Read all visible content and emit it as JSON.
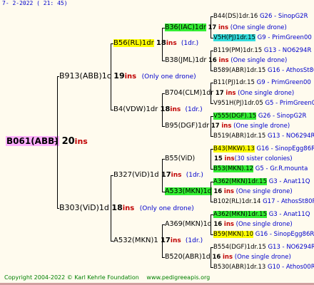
{
  "header": {
    "date": "7-  2-2022 ( 21: 45)"
  },
  "footer": {
    "copyright": "Copyright 2004-2022 © Karl Kehrle Foundation",
    "site": "www.pedigreeapis.org"
  },
  "colors": {
    "yellow": "#ffff00",
    "green": "#33ee33",
    "cyan": "#33dddd",
    "root": "#ffb0ff"
  },
  "tree": {
    "root": {
      "name": "B061(ABB)",
      "num": "20",
      "ins": "ins"
    },
    "g1": [
      {
        "name": "B913(ABB)1c",
        "num": "19",
        "ins": "ins",
        "note": "(Only one drone)"
      },
      {
        "name": "B303(ViD)1d",
        "num": "18",
        "ins": "ins",
        "note": "(Only one drone)"
      }
    ],
    "g2": [
      {
        "name": "B56(RL)1dr",
        "num": "18",
        "ins": "ins",
        "note": "(1dr.)"
      },
      {
        "name": "B4(VDW)1dr",
        "num": "18",
        "ins": "ins",
        "note": "(1dr.)"
      },
      {
        "name": "B327(ViD)1d",
        "num": "17",
        "ins": "ins",
        "note": "(1dr.)"
      },
      {
        "name": "A532(MKN)1",
        "num": "17",
        "ins": "ins",
        "note": "(1dr.)"
      }
    ],
    "g3": [
      {
        "name": "B36(IAC)1dr",
        "num": "17",
        "ins": "ins",
        "note": "(One single drone)"
      },
      {
        "name": "B38(JML)1dr",
        "num": "16",
        "ins": "ins",
        "note": "(One single drone)"
      },
      {
        "name": "B704(CLM)1dr",
        "num": "17",
        "ins": "ins",
        "note": "(One single drone)"
      },
      {
        "name": "B95(DGF)1dr",
        "num": "17",
        "ins": "ins",
        "note": "(One single drone)"
      },
      {
        "name": "B55(ViD)",
        "num": "15",
        "ins": "ins",
        "note": "(30 sister colonies)"
      },
      {
        "name": "A533(MKN)1d",
        "num": "16",
        "ins": "ins",
        "note": "(One single drone)"
      },
      {
        "name": "A369(MKN)1d",
        "num": "16",
        "ins": "ins",
        "note": "(One single drone)"
      },
      {
        "name": "B520(ABR)1d",
        "num": "16",
        "ins": "ins",
        "note": "(One single drone)"
      }
    ],
    "g4": [
      {
        "name": "B44(DS)1dr.16",
        "loc": "G26 - SinopG2R"
      },
      {
        "name": "V5H(PJ)1dr.15",
        "loc": "G9 - PrimGreen00"
      },
      {
        "name": "B119(PM)1dr.15",
        "loc": "G13 - NO6294R"
      },
      {
        "name": "B589(ABR)1dr.15",
        "loc": "G16 - AthosSt80R"
      },
      {
        "name": "B11(PJ)1dr.15",
        "loc": "G9 - PrimGreen00"
      },
      {
        "name": "V951H(PJ)1dr.05",
        "loc": "G5 - PrimGreen00"
      },
      {
        "name": "V555(DGF).15",
        "loc": "G26 - SinopG2R"
      },
      {
        "name": "B519(ABR)1dr.15",
        "loc": "G13 - NO6294R"
      },
      {
        "name": "B43(MKW).13",
        "loc": "G16 - SinopEgg86R"
      },
      {
        "name": "B53(MKN).12",
        "loc": "G5 - Gr.R.mounta"
      },
      {
        "name": "A362(MKN)1dr.15",
        "loc": "G3 - Anat11Q"
      },
      {
        "name": "B102(RL)1dr.14",
        "loc": "G17 - AthosSt80R"
      },
      {
        "name": "A362(MKN)1dr.15",
        "loc": "G3 - Anat11Q"
      },
      {
        "name": "B59(MKN).10",
        "loc": "G16 - SinopEgg86R"
      },
      {
        "name": "B554(DGF)1dr.15",
        "loc": "G13 - NO6294R"
      },
      {
        "name": "B530(ABR)1dr.13",
        "loc": "G10 - Athos00R"
      }
    ]
  }
}
